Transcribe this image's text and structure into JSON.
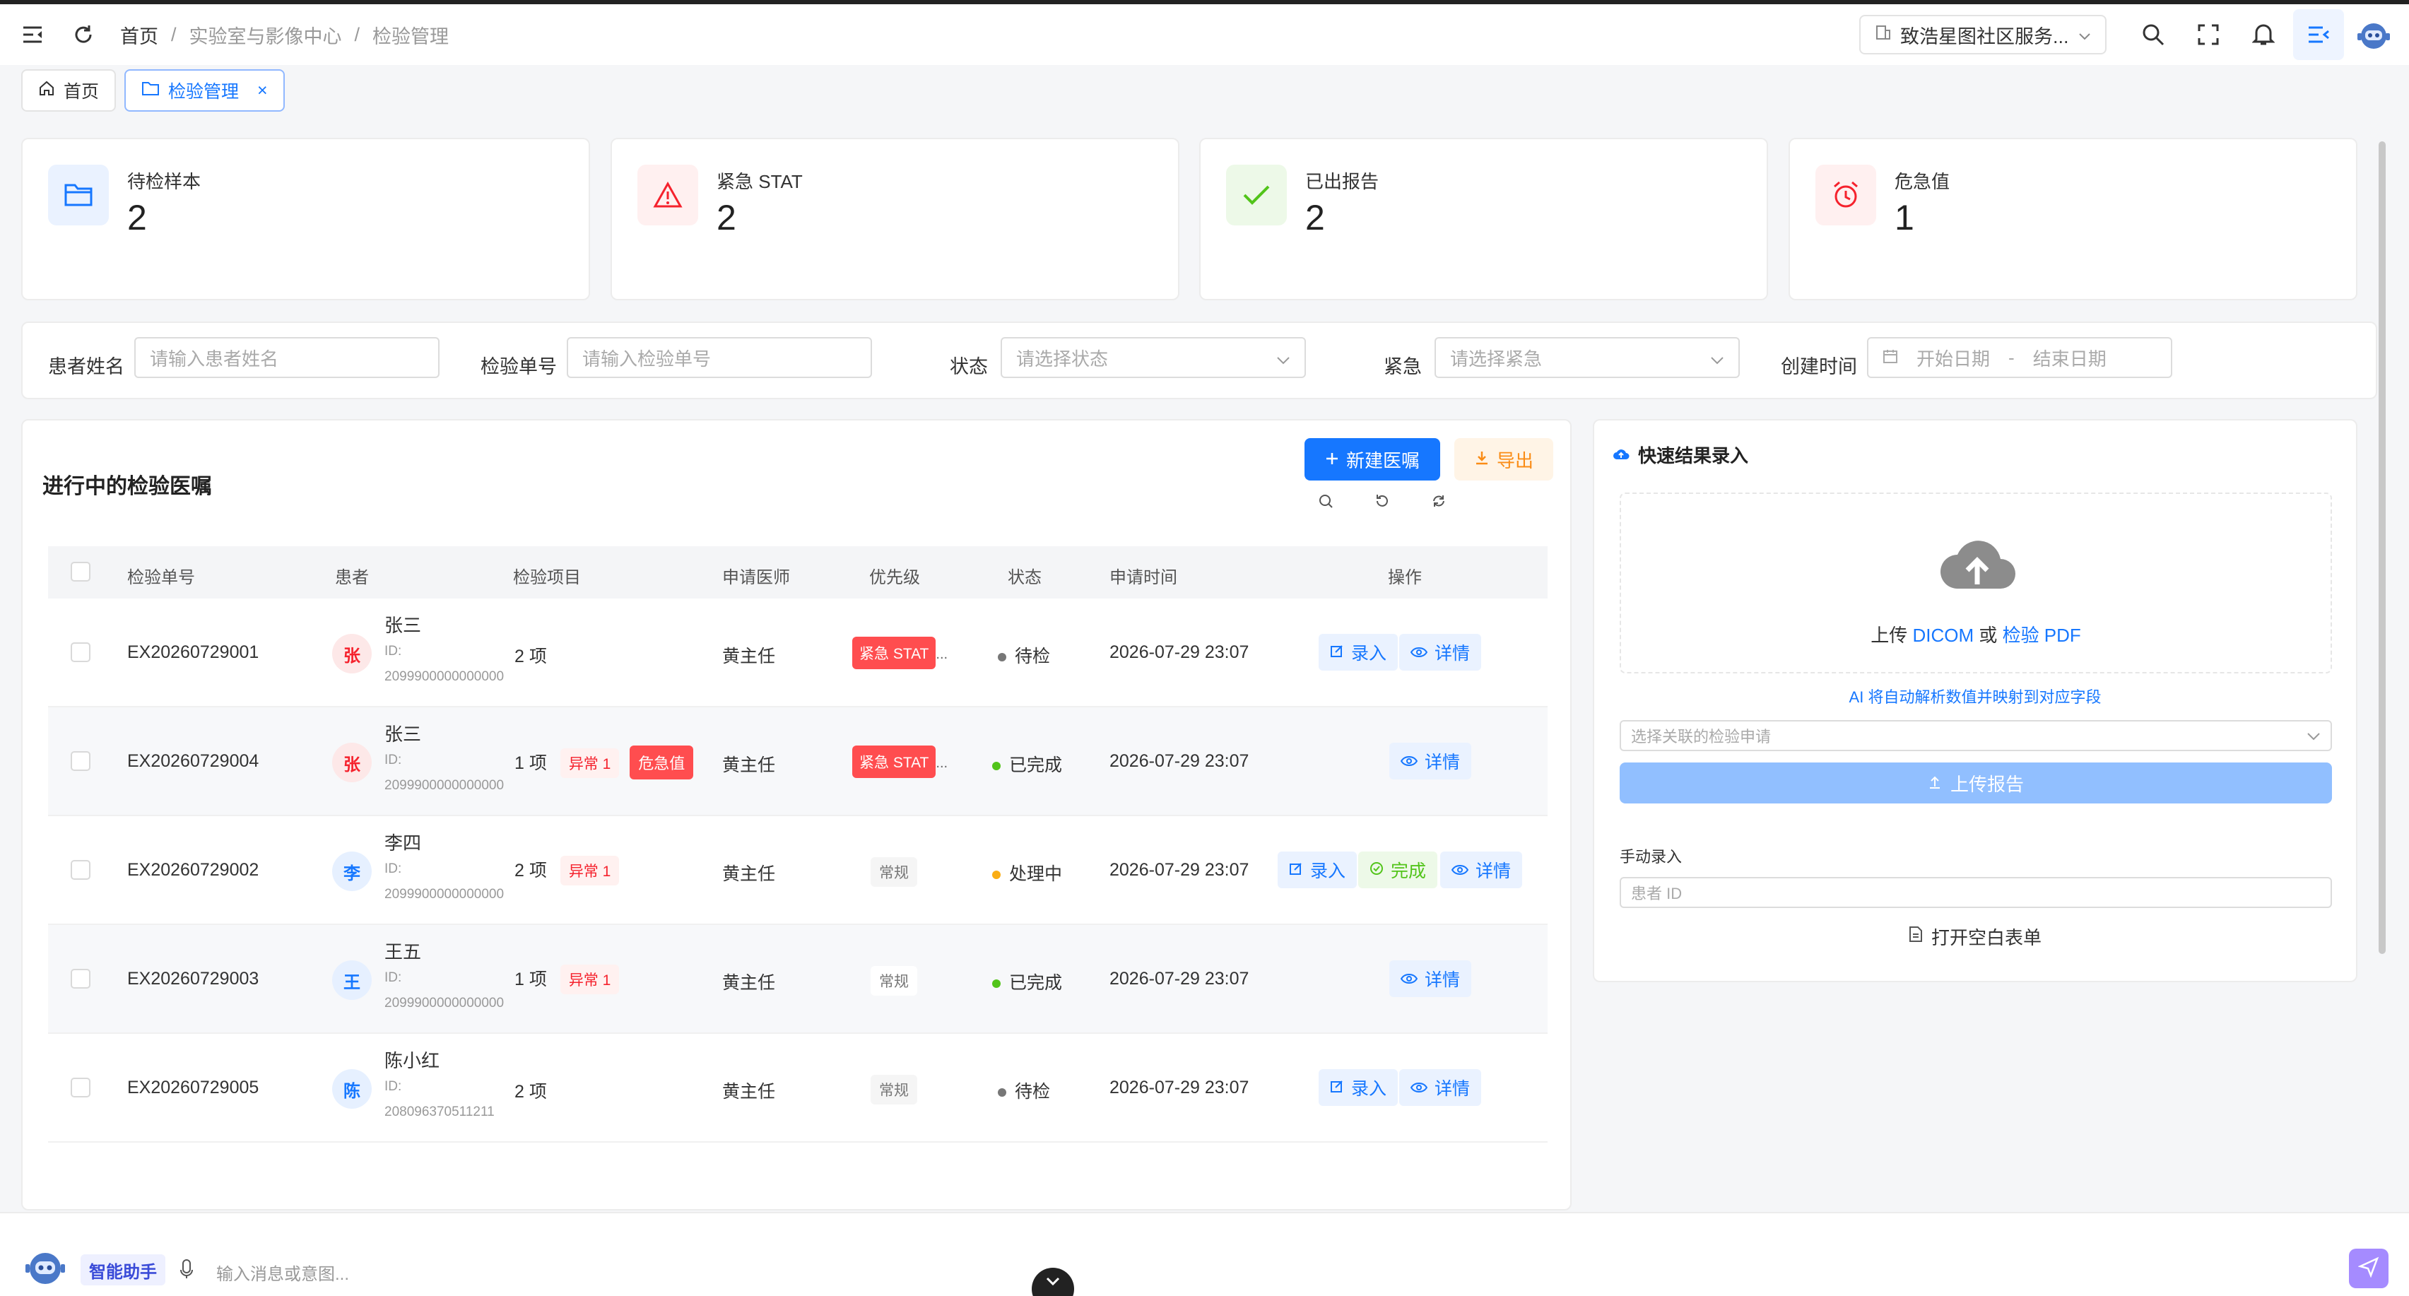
{
  "header": {
    "breadcrumb": [
      "首页",
      "实验室与影像中心",
      "检验管理"
    ],
    "breadcrumb_sep": "/",
    "org": "致浩星图社区服务..."
  },
  "tabs": [
    {
      "label": "首页",
      "active": false
    },
    {
      "label": "检验管理",
      "active": true,
      "close": "×"
    }
  ],
  "stats": [
    {
      "label": "待检样本",
      "value": "2",
      "icon": "folder-icon",
      "color": "#1677ff"
    },
    {
      "label": "紧急 STAT",
      "value": "2",
      "icon": "warning-icon",
      "color": "#f5222d"
    },
    {
      "label": "已出报告",
      "value": "2",
      "icon": "check-icon",
      "color": "#52c41a"
    },
    {
      "label": "危急值",
      "value": "1",
      "icon": "alarm-icon",
      "color": "#f5222d"
    }
  ],
  "filters": {
    "patient_label": "患者姓名",
    "patient_placeholder": "请输入患者姓名",
    "order_label": "检验单号",
    "order_placeholder": "请输入检验单号",
    "status_label": "状态",
    "status_placeholder": "请选择状态",
    "urgent_label": "紧急",
    "urgent_placeholder": "请选择紧急",
    "created_label": "创建时间",
    "start_placeholder": "开始日期",
    "date_sep": "-",
    "end_placeholder": "结束日期"
  },
  "orders": {
    "title": "进行中的检验医嘱",
    "new_label": "新建医嘱",
    "export_label": "导出",
    "columns": [
      "检验单号",
      "患者",
      "检验项目",
      "申请医师",
      "优先级",
      "状态",
      "申请时间",
      "操作"
    ],
    "id_prefix": "ID:",
    "rows": [
      {
        "order": "EX20260729001",
        "avatar": "张",
        "name": "张三",
        "pid": "2099900000000000",
        "items": "2 项",
        "abnormal": "",
        "critical": "",
        "doctor": "黄主任",
        "priority": "紧急 STAT",
        "priority_suffix": "...",
        "status": "待检",
        "time": "2026-07-29 23:07",
        "ops": [
          "录入",
          "详情"
        ]
      },
      {
        "order": "EX20260729004",
        "avatar": "张",
        "name": "张三",
        "pid": "2099900000000000",
        "items": "1 项",
        "abnormal": "异常 1",
        "critical": "危急值",
        "doctor": "黄主任",
        "priority": "紧急 STAT",
        "priority_suffix": "...",
        "status": "已完成",
        "time": "2026-07-29 23:07",
        "ops": [
          "详情"
        ]
      },
      {
        "order": "EX20260729002",
        "avatar": "李",
        "name": "李四",
        "pid": "2099900000000000",
        "items": "2 项",
        "abnormal": "异常 1",
        "critical": "",
        "doctor": "黄主任",
        "priority": "常规",
        "priority_suffix": "",
        "status": "处理中",
        "time": "2026-07-29 23:07",
        "ops": [
          "录入",
          "完成",
          "详情"
        ]
      },
      {
        "order": "EX20260729003",
        "avatar": "王",
        "name": "王五",
        "pid": "2099900000000000",
        "items": "1 项",
        "abnormal": "异常 1",
        "critical": "",
        "doctor": "黄主任",
        "priority": "常规",
        "priority_suffix": "",
        "status": "已完成",
        "time": "2026-07-29 23:07",
        "ops": [
          "详情"
        ]
      },
      {
        "order": "EX20260729005",
        "avatar": "陈",
        "name": "陈小红",
        "pid": "208096370511211",
        "items": "2 项",
        "abnormal": "",
        "critical": "",
        "doctor": "黄主任",
        "priority": "常规",
        "priority_suffix": "",
        "status": "待检",
        "time": "2026-07-29 23:07",
        "ops": [
          "录入",
          "详情"
        ]
      }
    ]
  },
  "quick": {
    "title": "快速结果录入",
    "upload_text_1": "上传 ",
    "upload_dicom": "DICOM",
    "upload_text_2": " 或 ",
    "upload_pdf": "检验 PDF",
    "ai_hint": "AI 将自动解析数值并映射到对应字段",
    "select_placeholder": "选择关联的检验申请",
    "upload_button": "上传报告",
    "manual_label": "手动录入",
    "pid_placeholder": "患者 ID",
    "open_form": "打开空白表单"
  },
  "assistant": {
    "label": "智能助手",
    "placeholder": "输入消息或意图..."
  },
  "colors": {
    "primary": "#1677ff",
    "danger": "#f5222d",
    "success": "#52c41a",
    "warning": "#faad14"
  }
}
